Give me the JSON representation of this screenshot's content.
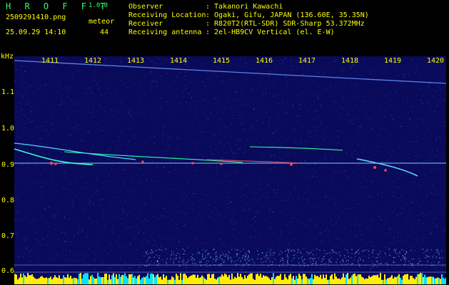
{
  "header": {
    "app_name": "H R O F F T",
    "version": "1.0.0",
    "filename": "2509291410.png",
    "datetime": "25.09.29 14:10",
    "meteor_label": "meteor",
    "meteor_count": "44",
    "info_rows": [
      {
        "label": "Observer",
        "value": ": Takanori Kawachi"
      },
      {
        "label": "Receiving Location",
        "value": ": Ogaki, Gifu, JAPAN (136.60E, 35.35N)"
      },
      {
        "label": "Receiver",
        "value": ": R820T2(RTL-SDR) SDR-Sharp 53.372MHz"
      },
      {
        "label": "Receiving antenna",
        "value": ": 2el-HB9CV Vertical (el. E-W)"
      }
    ]
  },
  "spectrogram": {
    "y_unit": "kHz",
    "y_ticks": [
      "1.1",
      "1.0",
      "0.9",
      "0.8",
      "0.7",
      "0.6"
    ],
    "x_ticks": [
      "1411",
      "1412",
      "1413",
      "1414",
      "1415",
      "1416",
      "1417",
      "1418",
      "1419",
      "1420"
    ],
    "background_color": "#0a0a5a",
    "carrier_color": "#66ccff",
    "bar_color_primary": "#ffee00",
    "bar_color_secondary": "#00e5ff"
  }
}
